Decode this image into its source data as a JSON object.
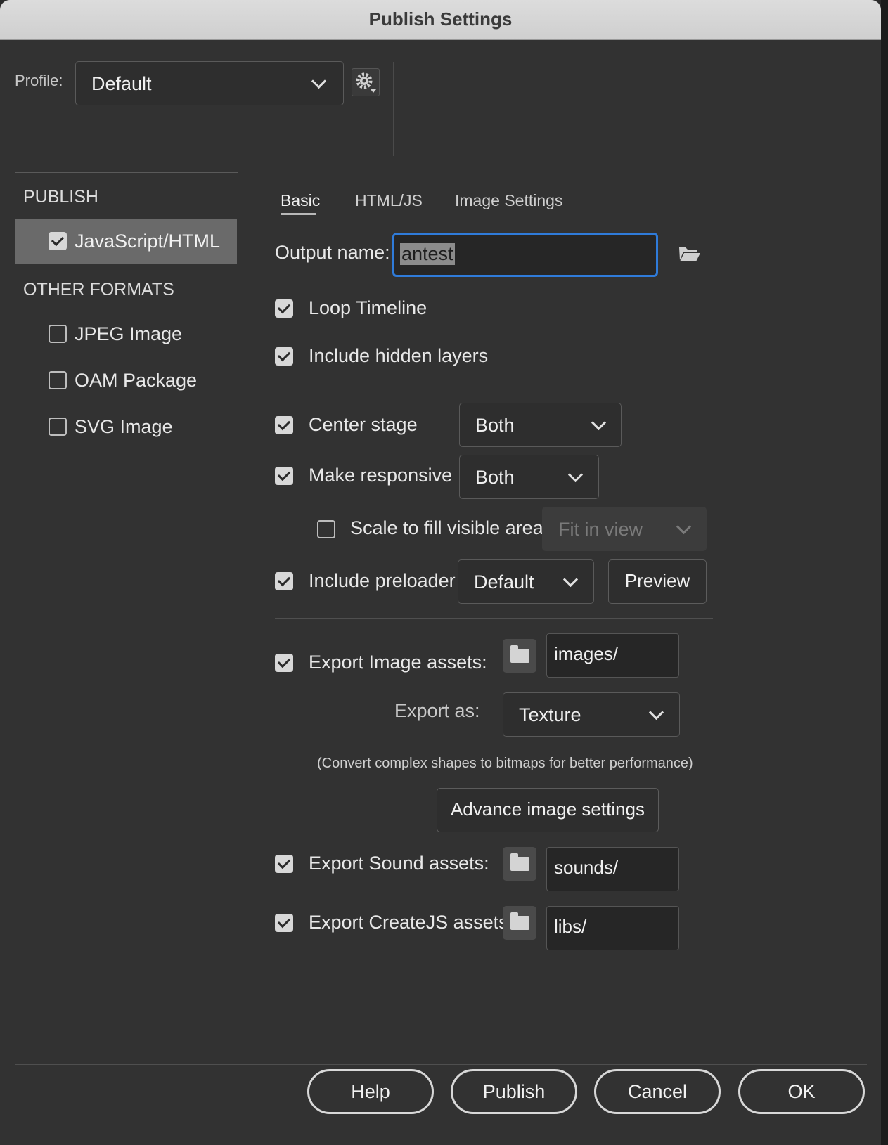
{
  "window": {
    "title": "Publish Settings"
  },
  "profile": {
    "label": "Profile:",
    "value": "Default"
  },
  "sidebar": {
    "publish_header": "PUBLISH",
    "publish_items": [
      {
        "label": "JavaScript/HTML",
        "checked": true,
        "selected": true
      }
    ],
    "other_header": "OTHER FORMATS",
    "other_items": [
      {
        "label": "JPEG Image",
        "checked": false
      },
      {
        "label": "OAM Package",
        "checked": false
      },
      {
        "label": "SVG Image",
        "checked": false
      }
    ]
  },
  "tabs": [
    {
      "label": "Basic",
      "active": true
    },
    {
      "label": "HTML/JS",
      "active": false
    },
    {
      "label": "Image Settings",
      "active": false
    }
  ],
  "basic": {
    "output_name_label": "Output name:",
    "output_name_value": "antest",
    "loop_timeline": "Loop Timeline",
    "include_hidden_layers": "Include hidden layers",
    "center_stage": {
      "label": "Center stage",
      "value": "Both"
    },
    "make_responsive": {
      "label": "Make responsive",
      "value": "Both"
    },
    "scale_to_fill": {
      "label": "Scale to fill visible area",
      "value": "Fit in view"
    },
    "include_preloader": {
      "label": "Include preloader",
      "value": "Default",
      "preview_label": "Preview"
    },
    "export_image_assets": {
      "label": "Export Image assets:",
      "path": "images/"
    },
    "export_as": {
      "label": "Export as:",
      "value": "Texture"
    },
    "convert_note": "(Convert complex shapes to bitmaps for better performance)",
    "advance_image_settings": "Advance image settings",
    "export_sound_assets": {
      "label": "Export Sound assets:",
      "path": "sounds/"
    },
    "export_createjs_assets": {
      "label": "Export CreateJS assets:",
      "path": "libs/"
    }
  },
  "footer": {
    "help": "Help",
    "publish": "Publish",
    "cancel": "Cancel",
    "ok": "OK"
  },
  "colors": {
    "accent": "#2f7bd9",
    "window_bg": "#323232",
    "selected_row": "#6a6a6a"
  }
}
